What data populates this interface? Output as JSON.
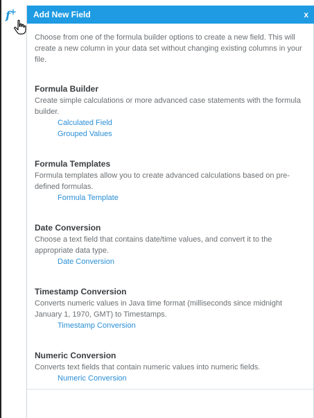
{
  "toolbar": {
    "formula_icon": "f-plus-icon",
    "cursor_icon": "hand-pointer-icon"
  },
  "panel": {
    "title": "Add New Field",
    "close_label": "x",
    "intro": "Choose from one of the formula builder options to create a new field. This will create a new column in your data set without changing existing columns in your file.",
    "sections": [
      {
        "title": "Formula Builder",
        "description": "Create simple calculations or more advanced case statements with the formula builder.",
        "links": [
          "Calculated Field",
          "Grouped Values"
        ]
      },
      {
        "title": "Formula Templates",
        "description": "Formula templates allow you to create advanced calculations based on pre-defined formulas.",
        "links": [
          "Formula Template"
        ]
      },
      {
        "title": "Date Conversion",
        "description": "Choose a text field that contains date/time values, and convert it to the appropriate data type.",
        "links": [
          "Date Conversion"
        ]
      },
      {
        "title": "Timestamp Conversion",
        "description": "Converts numeric values in Java time format (milliseconds since midnight January 1, 1970, GMT) to Timestamps.",
        "links": [
          "Timestamp Conversion"
        ]
      },
      {
        "title": "Numeric Conversion",
        "description": "Converts text fields that contain numeric values into numeric fields.",
        "links": [
          "Numeric Conversion"
        ]
      }
    ]
  },
  "colors": {
    "header": "#1e9be3",
    "link": "#2a8fd6",
    "text": "#6b6f73",
    "heading": "#3a3d40"
  }
}
